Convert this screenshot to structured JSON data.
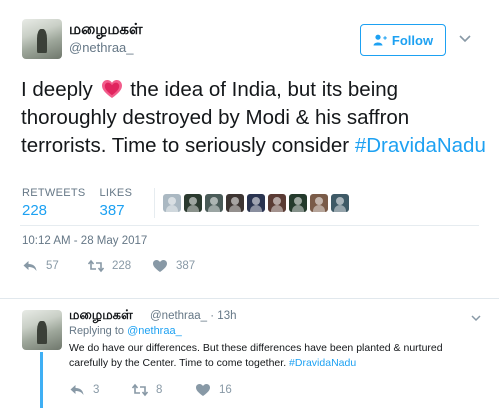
{
  "tweet": {
    "author_name": "மழைமகள்",
    "author_handle": "@nethraa_",
    "follow_label": "Follow",
    "text_before": "I deeply",
    "text_after": "the idea of India, but its being thoroughly destroyed by Modi & his saffron terrorists. Time to seriously consider",
    "hashtag": "#DravidaNadu",
    "retweets_label": "RETWEETS",
    "retweets_count": "228",
    "likes_label": "LIKES",
    "likes_count": "387",
    "timestamp": "10:12 AM - 28 May 2017",
    "actions": {
      "reply_count": "57",
      "retweet_count": "228",
      "like_count": "387"
    }
  },
  "likers": [
    {
      "icon": "default-egg-avatar",
      "color": "#aab8c2"
    },
    {
      "icon": "avatar",
      "color": "#2b3a2f"
    },
    {
      "icon": "avatar",
      "color": "#4a5b58"
    },
    {
      "icon": "avatar",
      "color": "#3d3532"
    },
    {
      "icon": "avatar",
      "color": "#2a3450"
    },
    {
      "icon": "avatar",
      "color": "#5a3b34"
    },
    {
      "icon": "avatar",
      "color": "#243a2c"
    },
    {
      "icon": "avatar",
      "color": "#7a5b48"
    },
    {
      "icon": "avatar",
      "color": "#3e5a66"
    }
  ],
  "reply": {
    "author_name": "மழைமகள்",
    "handle_time": "@nethraa_ · 13h",
    "replying_prefix": "Replying to",
    "replying_handle": "@nethraa_",
    "text": "We do have our differences. But these differences have been planted & nurtured carefully by the Center. Time to come together.",
    "hashtag": "#DravidaNadu",
    "actions": {
      "reply_count": "3",
      "retweet_count": "8",
      "like_count": "16"
    }
  },
  "colors": {
    "accent": "#1da1f2",
    "muted": "#657786",
    "heart_emoji": "#e0245e"
  }
}
